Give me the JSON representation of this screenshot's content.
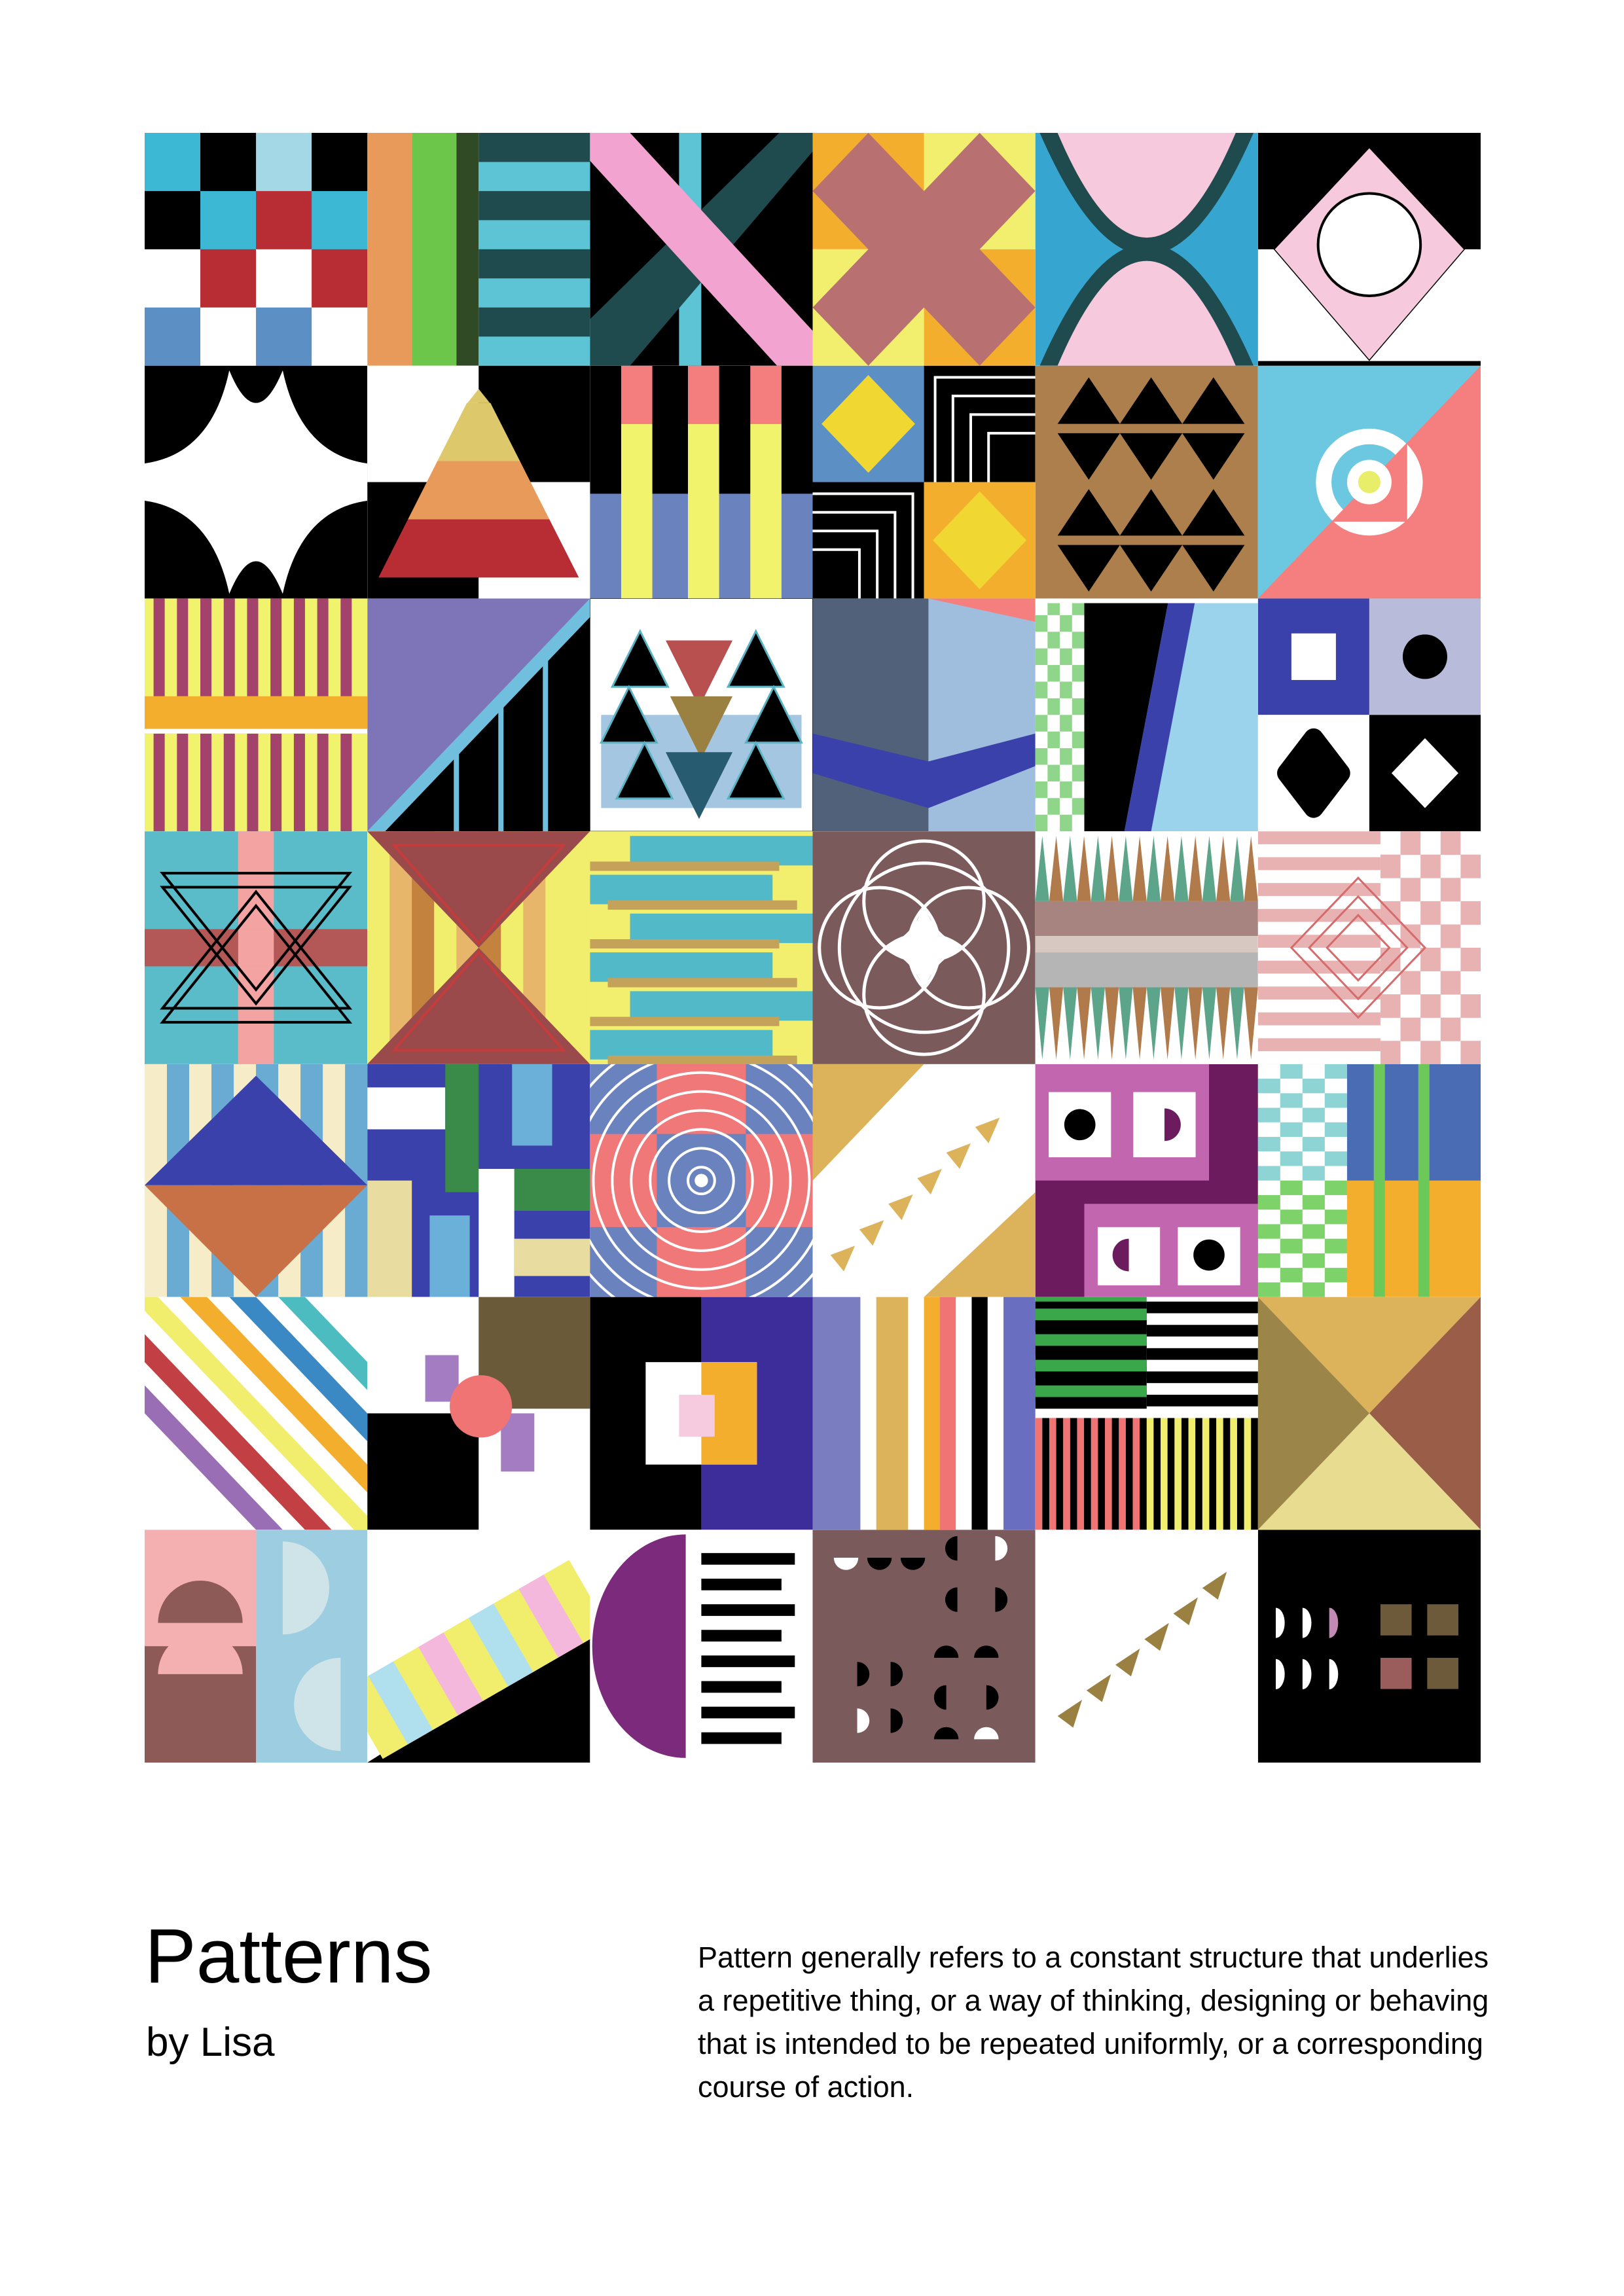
{
  "poster": {
    "title": "Patterns",
    "byline": "by Lisa",
    "description": "Pattern generally refers to a constant structure that underlies a repetitive thing, or a way of thinking, designing or behaving that is intended to be repeated uniformly, or a corresponding course of action."
  },
  "grid": {
    "columns": 6,
    "rows": 7,
    "tile_count": 42
  },
  "palette": {
    "black": "#000000",
    "white": "#ffffff",
    "cyan": "#3db8d4",
    "light_cyan": "#a4d8e6",
    "red": "#b82c33",
    "steel_blue": "#5c8fc4",
    "orange": "#e89a5a",
    "green": "#6cc64a",
    "dark_green": "#2f4a25",
    "dark_teal": "#1f4a4e",
    "teal": "#5cc4d4",
    "pink": "#f3a3cf",
    "mauve": "#b87070",
    "yellow": "#f3ef6e",
    "amber": "#f4ae2e",
    "sky": "#36a5cf",
    "light_pink": "#f6c9dc",
    "tan": "#ddc86c",
    "coral": "#f47d7d",
    "lemon": "#f1f36d",
    "periwinkle": "#6a82be",
    "brown": "#ad7f4c",
    "rose": "#f57f7f",
    "raspberry": "#a3426b",
    "purple": "#7e75b9",
    "slate": "#506179",
    "indigo": "#3b41ab",
    "lavender": "#b8bcda",
    "plum": "#6d1b5f",
    "khaki": "#c4a259",
    "olive": "#6b5b3b",
    "wine": "#935e63",
    "taupe": "#6f5a58",
    "mud": "#9b8141"
  }
}
